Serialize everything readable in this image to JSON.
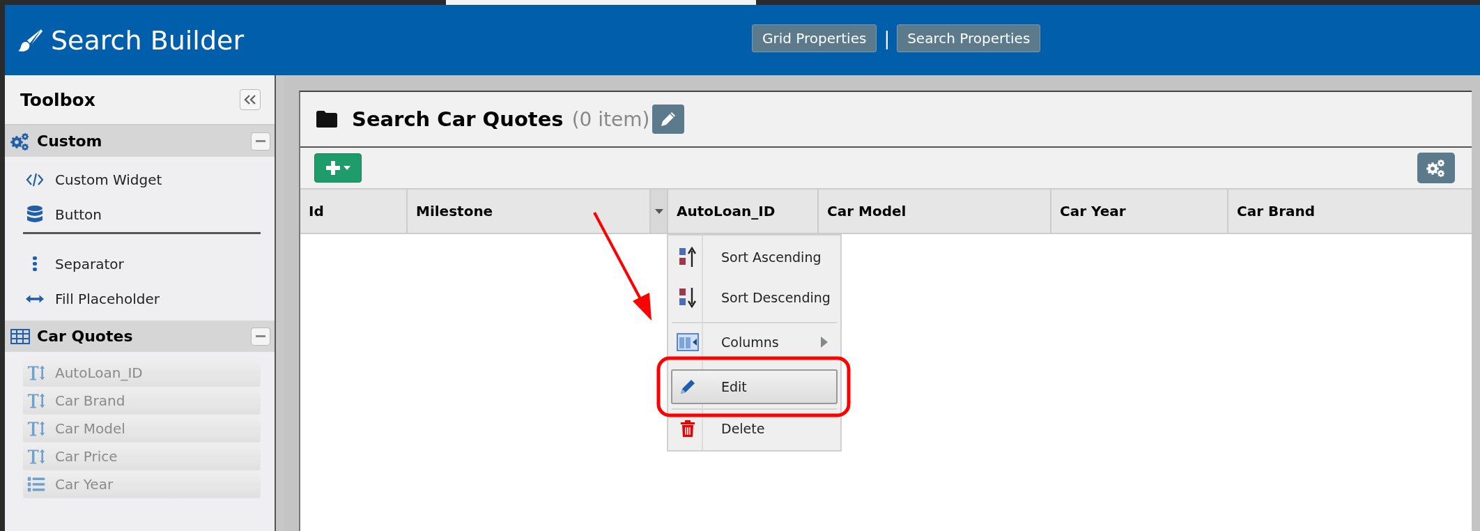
{
  "header": {
    "title": "Search Builder",
    "buttons": [
      "Grid Properties",
      "Search Properties"
    ],
    "separator": "|"
  },
  "toolbox": {
    "title": "Toolbox",
    "sections": [
      {
        "title": "Custom",
        "kind": "tools",
        "expanded": true,
        "groups": [
          [
            {
              "label": "Custom Widget",
              "kind": "code"
            },
            {
              "label": "Button",
              "kind": "database"
            }
          ],
          [
            {
              "label": "Separator",
              "kind": "dots"
            },
            {
              "label": "Fill Placeholder",
              "kind": "arrows"
            }
          ]
        ]
      },
      {
        "title": "Car Quotes",
        "kind": "fields",
        "expanded": true,
        "groups": [
          [
            {
              "label": "AutoLoan_ID",
              "kind": "text"
            },
            {
              "label": "Car Brand",
              "kind": "text"
            },
            {
              "label": "Car Model",
              "kind": "text"
            },
            {
              "label": "Car Price",
              "kind": "text"
            },
            {
              "label": "Car Year",
              "kind": "list"
            }
          ]
        ]
      }
    ]
  },
  "grid": {
    "title": "Search Car Quotes",
    "count": "(0 item)",
    "columns": [
      {
        "label": "Id",
        "menu_open": false
      },
      {
        "label": "Milestone",
        "menu_open": true
      },
      {
        "label": "AutoLoan_ID",
        "menu_open": false
      },
      {
        "label": "Car Model",
        "menu_open": false
      },
      {
        "label": "Car Year",
        "menu_open": false
      },
      {
        "label": "Car Brand",
        "menu_open": false
      }
    ],
    "column_menu": [
      {
        "label": "Sort Ascending",
        "kind": "sort-asc",
        "selected": false,
        "separator_before": false,
        "submenu": false,
        "annotated": false
      },
      {
        "label": "Sort Descending",
        "kind": "sort-desc",
        "selected": false,
        "separator_before": false,
        "submenu": false,
        "annotated": false
      },
      {
        "label": "Columns",
        "kind": "columns",
        "selected": false,
        "separator_before": true,
        "submenu": true,
        "annotated": false
      },
      {
        "label": "Edit",
        "kind": "edit",
        "selected": true,
        "separator_before": true,
        "submenu": false,
        "annotated": true
      },
      {
        "label": "Delete",
        "kind": "delete",
        "selected": false,
        "separator_before": true,
        "submenu": false,
        "annotated": false
      }
    ]
  }
}
